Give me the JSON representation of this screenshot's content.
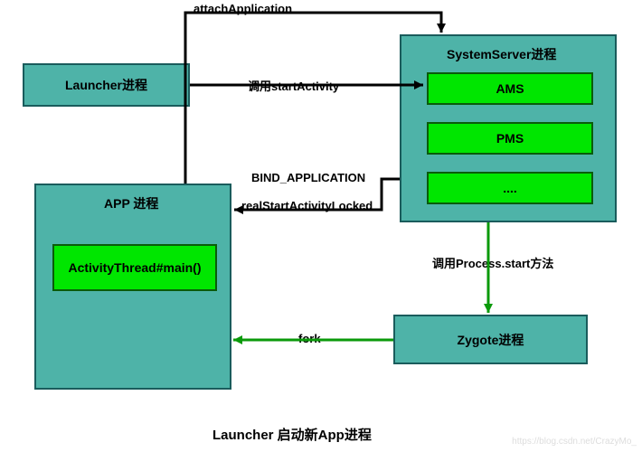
{
  "boxes": {
    "launcher": "Launcher进程",
    "app_container_title": "APP 进程",
    "activity_thread": "ActivityThread#main()",
    "system_server_title": "SystemServer进程",
    "ams": "AMS",
    "pms": "PMS",
    "dots": "....",
    "zygote": "Zygote进程"
  },
  "labels": {
    "attach_application": "attachApplication",
    "start_activity": "调用startActivity",
    "bind_application": "BIND_APPLICATION",
    "real_start": "realStartActivityLocked",
    "process_start": "调用Process.start方法",
    "fork": "fork"
  },
  "caption": "Launcher 启动新App进程",
  "watermark": "https://blog.csdn.net/CrazyMo_"
}
